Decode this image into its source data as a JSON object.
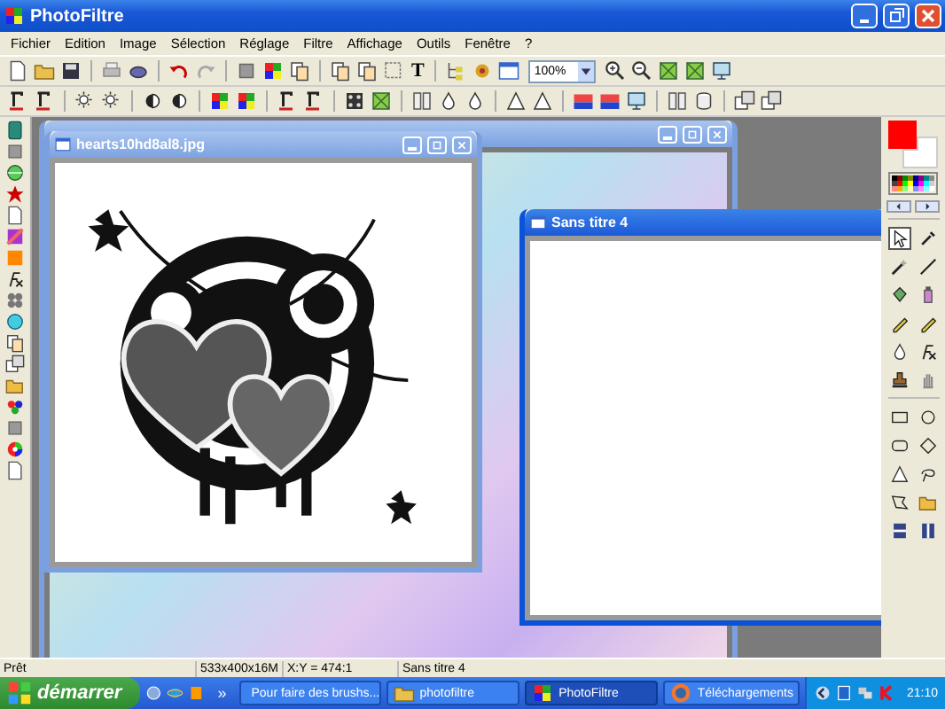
{
  "window": {
    "title": "PhotoFiltre"
  },
  "menu": [
    "Fichier",
    "Edition",
    "Image",
    "Sélection",
    "Réglage",
    "Filtre",
    "Affichage",
    "Outils",
    "Fenêtre",
    "?"
  ],
  "toolbar": {
    "zoom": "100%",
    "text_tool": "T"
  },
  "documents": [
    {
      "kind": "background",
      "selected": false
    },
    {
      "kind": "image",
      "title": "hearts10hd8al8.jpg",
      "selected": false
    },
    {
      "kind": "blank",
      "title": "Sans titre 4",
      "selected": true
    }
  ],
  "swatches": [
    {
      "kind": "foreground",
      "color": "#ff0000"
    },
    {
      "kind": "background",
      "color": "#ffffff"
    }
  ],
  "status_bar": [
    "Prêt",
    "533x400x16M",
    "X:Y = 474:1",
    "Sans titre 4"
  ],
  "taskbar": {
    "start": "démarrer",
    "more": "»",
    "tasks": [
      {
        "label": "Pour faire des brushs...",
        "selected": false
      },
      {
        "label": "photofiltre",
        "selected": false
      },
      {
        "label": "PhotoFiltre",
        "selected": true
      },
      {
        "label": "Téléchargements",
        "selected": false
      }
    ],
    "clock": "21:10"
  }
}
